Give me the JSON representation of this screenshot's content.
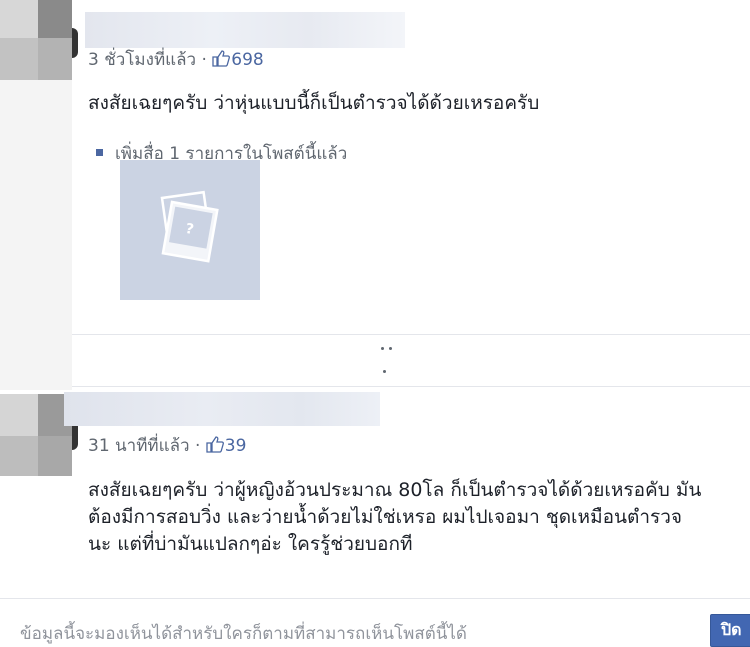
{
  "post1": {
    "time": "3 ชั่วโมงที่แล้ว",
    "separator": "·",
    "likes": "698",
    "text": "สงสัยเฉยๆครับ ว่าหุ่นแบบนี้ก็เป็นตำรวจได้ด้วยเหรอครับ",
    "media_note": "เพิ่มสื่อ 1 รายการในโพสต์นี้แล้ว"
  },
  "post2": {
    "time": "31 นาทีที่แล้ว",
    "separator": "·",
    "likes": "39",
    "lines": [
      "สงสัยเฉยๆครับ ว่าผู้หญิงอ้วนประมาณ 80โล ก็เป็นตำรวจได้ด้วยเหรอคับ มัน",
      "ต้องมีการสอบวิ่ง และว่ายน้ำด้วยไม่ใช่เหรอ ผมไปเจอมา ชุดเหมือนตำรวจ",
      "นะ แต่ที่บ่ามันแปลกๆอ่ะ ใครรู้ช่วยบอกที"
    ]
  },
  "footer": {
    "text": "ข้อมูลนี้จะมองเห็นได้สำหรับใครก็ตามที่สามารถเห็นโพสต์นี้ได้",
    "close_label": "ปิด"
  },
  "colors": {
    "accent": "#4267b2",
    "like": "#4b67a1",
    "placeholder": "#cbd3e3"
  },
  "icons": [
    "thumbs-up-icon",
    "photo-placeholder-icon",
    "bullet-icon",
    "more-dots-icon"
  ]
}
